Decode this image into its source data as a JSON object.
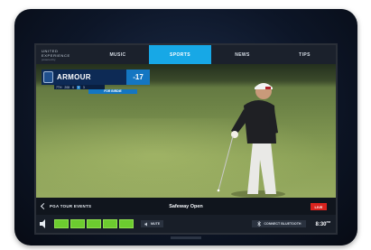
{
  "brand": {
    "line1": "UNITED",
    "line2": "EXPERIENCE",
    "line3": "powered by"
  },
  "nav": {
    "tabs": [
      {
        "label": "MUSIC",
        "active": false
      },
      {
        "label": "SPORTS",
        "active": true
      },
      {
        "label": "NEWS",
        "active": false
      },
      {
        "label": "TIPS",
        "active": false
      }
    ]
  },
  "scorebug": {
    "player": "ARMOUR",
    "score": "-17",
    "stats": [
      "7TH",
      "208",
      "6",
      "5",
      "3"
    ],
    "round_label": "FOR BIRDIE"
  },
  "infobar": {
    "back_label": "PGA TOUR EVENTS",
    "event_title": "Safeway Open",
    "live_badge": "LIVE"
  },
  "controls": {
    "volume_level": "5 of 5",
    "mute_label": "MUTE",
    "bluetooth_label": "CONNECT BLUETOOTH",
    "time": "8:30",
    "time_suffix": "PM"
  },
  "colors": {
    "accent": "#17a8e6",
    "volume": "#6ccc2f",
    "live": "#d9231e",
    "scorebug": "#0d2a55"
  }
}
